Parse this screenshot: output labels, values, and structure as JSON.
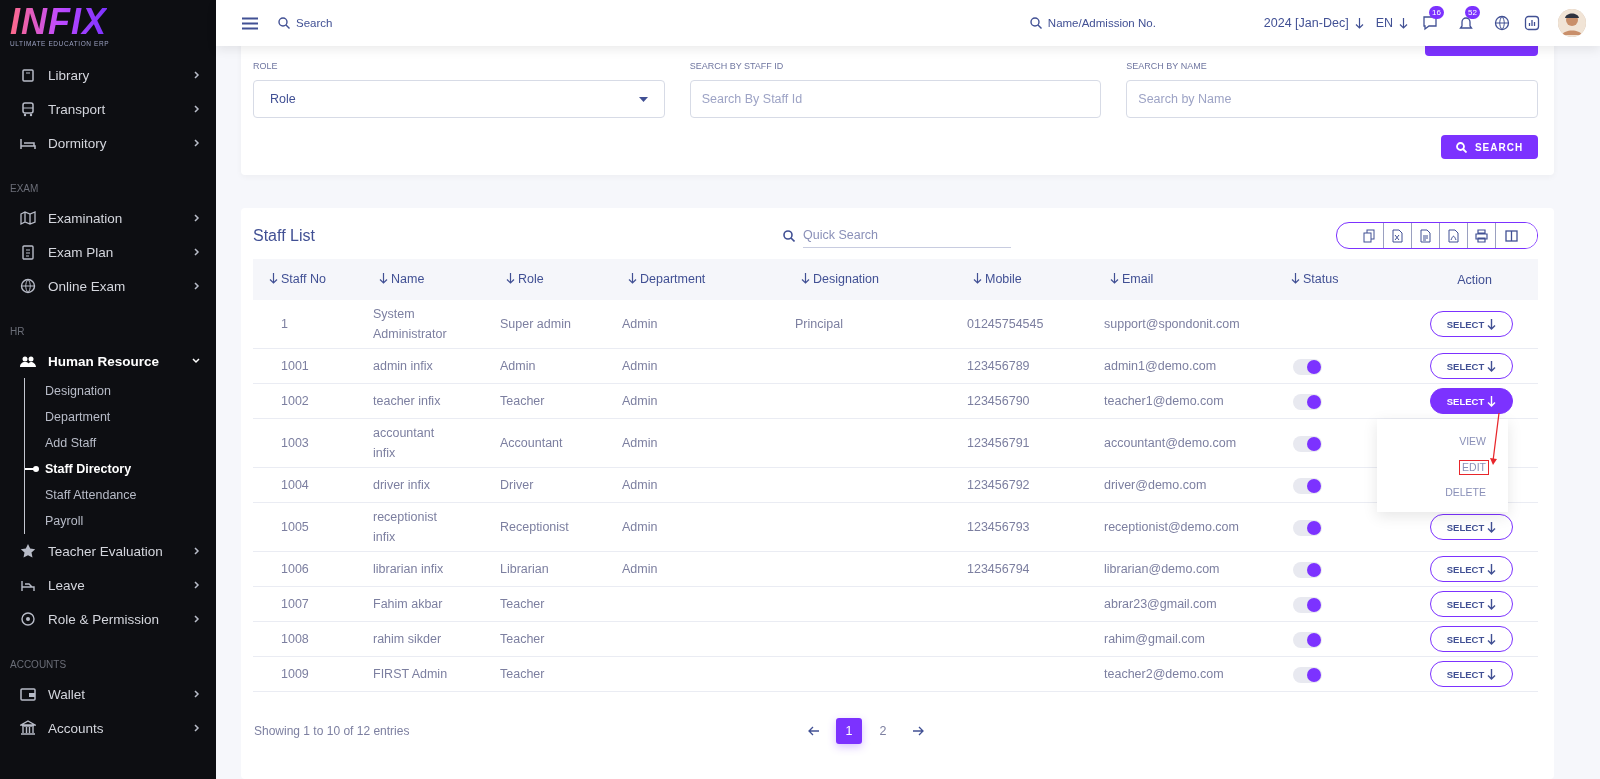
{
  "logo": {
    "name": "INFIX",
    "tagline": "ULTIMATE EDUCATION ERP"
  },
  "sidebar": {
    "sections": [
      {
        "items": [
          {
            "label": "Library"
          },
          {
            "label": "Transport"
          },
          {
            "label": "Dormitory"
          }
        ]
      },
      {
        "heading": "EXAM",
        "items": [
          {
            "label": "Examination"
          },
          {
            "label": "Exam Plan"
          },
          {
            "label": "Online Exam"
          }
        ]
      },
      {
        "heading": "HR",
        "items": [
          {
            "label": "Human Resource",
            "expanded": true,
            "children": [
              {
                "label": "Designation",
                "selected": false
              },
              {
                "label": "Department",
                "selected": false
              },
              {
                "label": "Add Staff",
                "selected": false
              },
              {
                "label": "Staff Directory",
                "selected": true
              },
              {
                "label": "Staff Attendance",
                "selected": false
              },
              {
                "label": "Payroll",
                "selected": false
              }
            ]
          },
          {
            "label": "Teacher Evaluation"
          },
          {
            "label": "Leave"
          },
          {
            "label": "Role & Permission"
          }
        ]
      },
      {
        "heading": "ACCOUNTS",
        "items": [
          {
            "label": "Wallet"
          },
          {
            "label": "Accounts"
          }
        ]
      }
    ]
  },
  "header": {
    "search": "Search",
    "student_search": "Name/Admission No.",
    "session": "2024 [Jan-Dec]",
    "language": "EN",
    "messages_badge": "16",
    "notifications_badge": "52"
  },
  "criteria": {
    "fields": [
      {
        "kind": "select",
        "label": "ROLE",
        "value": "Role"
      },
      {
        "kind": "input",
        "label": "SEARCH BY STAFF ID",
        "placeholder": "Search By Staff Id"
      },
      {
        "kind": "input",
        "label": "SEARCH BY NAME",
        "placeholder": "Search by Name"
      }
    ],
    "search_button": "SEARCH"
  },
  "staff_list": {
    "title": "Staff List",
    "quick_search": {
      "placeholder": "Quick Search"
    },
    "columns": [
      "Staff No",
      "Name",
      "Role",
      "Department",
      "Designation",
      "Mobile",
      "Email",
      "Status",
      "Action"
    ],
    "rows": [
      {
        "staff_no": "1",
        "name": "System Administrator",
        "role": "Super admin",
        "department": "Admin",
        "designation": "Principal",
        "mobile": "01245754545",
        "email": "support@spondonit.com",
        "action": {
          "label": "SELECT",
          "selected": false
        }
      },
      {
        "staff_no": "1001",
        "name": "admin infix",
        "role": "Admin",
        "department": "Admin",
        "mobile": "123456789",
        "email": "admin1@demo.com",
        "status": true,
        "action": {
          "label": "SELECT",
          "selected": false
        }
      },
      {
        "staff_no": "1002",
        "name": "teacher infix",
        "role": "Teacher",
        "department": "Admin",
        "mobile": "123456790",
        "email": "teacher1@demo.com",
        "status": true,
        "action": {
          "label": "SELECT",
          "selected": true
        },
        "menu": [
          {
            "label": "VIEW",
            "highlighted": false
          },
          {
            "label": "EDIT",
            "highlighted": true
          },
          {
            "label": "DELETE",
            "highlighted": false
          }
        ]
      },
      {
        "staff_no": "1003",
        "name": "accountant infix",
        "role": "Accountant",
        "department": "Admin",
        "mobile": "123456791",
        "email": "accountant@demo.com",
        "status": true
      },
      {
        "staff_no": "1004",
        "name": "driver infix",
        "role": "Driver",
        "department": "Admin",
        "mobile": "123456792",
        "email": "driver@demo.com",
        "status": true
      },
      {
        "staff_no": "1005",
        "name": "receptionist infix",
        "role": "Receptionist",
        "department": "Admin",
        "mobile": "123456793",
        "email": "receptionist@demo.com",
        "status": true,
        "action": {
          "label": "SELECT",
          "selected": false
        }
      },
      {
        "staff_no": "1006",
        "name": "librarian infix",
        "role": "Librarian",
        "department": "Admin",
        "mobile": "123456794",
        "email": "librarian@demo.com",
        "status": true,
        "action": {
          "label": "SELECT",
          "selected": false
        }
      },
      {
        "staff_no": "1007",
        "name": "Fahim akbar",
        "role": "Teacher",
        "email": "abrar23@gmail.com",
        "status": true,
        "action": {
          "label": "SELECT",
          "selected": false
        }
      },
      {
        "staff_no": "1008",
        "name": "rahim sikder",
        "role": "Teacher",
        "email": "rahim@gmail.com",
        "status": true,
        "action": {
          "label": "SELECT",
          "selected": false
        }
      },
      {
        "staff_no": "1009",
        "name": "FIRST Admin",
        "role": "Teacher",
        "email": "teacher2@demo.com",
        "status": true,
        "action": {
          "label": "SELECT",
          "selected": false
        }
      }
    ],
    "summary": "Showing 1 to 10 of 12 entries",
    "pages": [
      {
        "label": "1",
        "selected": true
      },
      {
        "label": "2",
        "selected": false
      }
    ]
  }
}
